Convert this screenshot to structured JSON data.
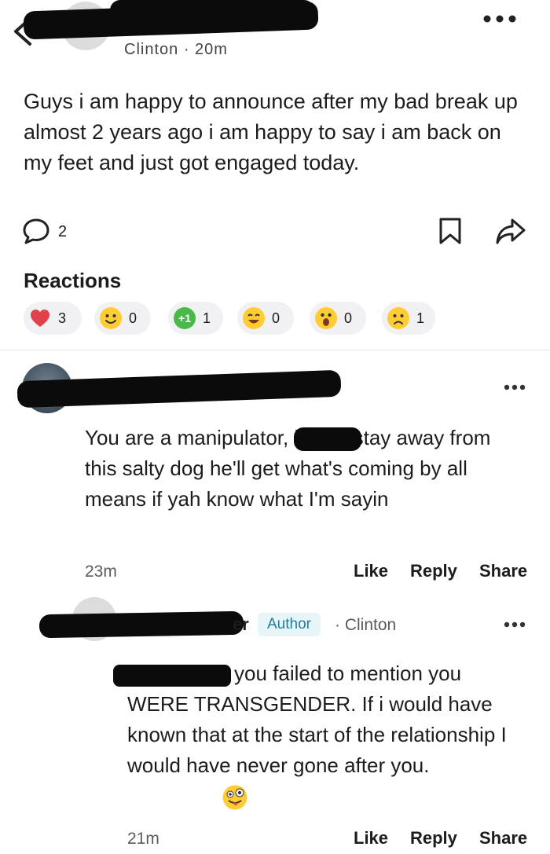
{
  "header": {
    "meta": "Clinton · 20m"
  },
  "post": {
    "text": "Guys i am happy to announce after my bad break up almost 2 years ago i am happy to say i am back on my feet and just got engaged today.",
    "comment_count": "2"
  },
  "reactions": {
    "title": "Reactions",
    "items": [
      {
        "icon": "heart-icon",
        "count": "3"
      },
      {
        "icon": "smile-icon",
        "count": "0"
      },
      {
        "icon": "plus-one-icon",
        "label": "+1",
        "count": "1"
      },
      {
        "icon": "laugh-icon",
        "count": "0"
      },
      {
        "icon": "surprised-icon",
        "count": "0"
      },
      {
        "icon": "sad-icon",
        "count": "1"
      }
    ]
  },
  "comments": [
    {
      "text": "You are a manipulator, ladies stay away from this salty dog he'll get what's coming by all means if yah know what I'm sayin",
      "time": "23m",
      "actions": {
        "like": "Like",
        "reply": "Reply",
        "share": "Share"
      }
    },
    {
      "badge": "Author",
      "location": "· Clinton",
      "text": "you failed to mention you WERE TRANSGENDER. If i would have known that at the start of the relationship I would have never gone after you.",
      "time": "21m",
      "actions": {
        "like": "Like",
        "reply": "Reply",
        "share": "Share"
      }
    }
  ],
  "colors": {
    "accent_teal": "#1a7f9c",
    "reaction_pill": "#f1f1f3",
    "heart": "#e0414b",
    "emoji_yellow": "#ffcc33",
    "plus_one": "#4bb84b"
  }
}
